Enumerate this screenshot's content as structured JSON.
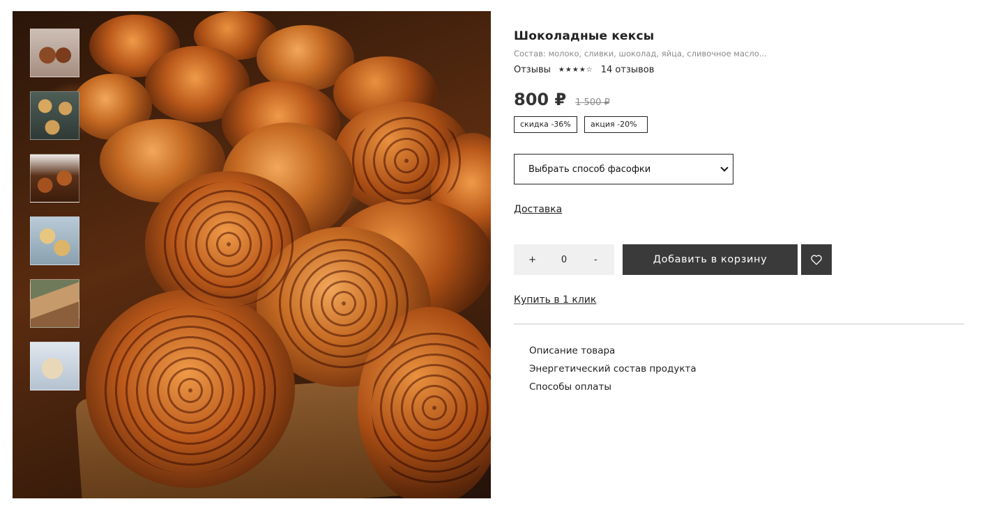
{
  "gallery": {
    "main_image": "cinnamon-rolls-photo",
    "thumbnails": [
      {
        "icon": "chocolate-cupcakes-thumbnail"
      },
      {
        "icon": "cookies-thumbnail"
      },
      {
        "icon": "cinnamon-buns-thumbnail"
      },
      {
        "icon": "blueberry-muffins-thumbnail"
      },
      {
        "icon": "pie-slices-thumbnail"
      },
      {
        "icon": "blueberry-pastry-thumbnail"
      }
    ]
  },
  "product": {
    "title": "Шоколадные кексы",
    "composition": "Состав: молоко, сливки, шоколад, яйца, сливочное масло...",
    "reviews_label": "Отзывы",
    "rating": 4,
    "rating_max": 5,
    "stars_text": "★★★★☆",
    "reviews_count": "14 отзывов",
    "price": "800 ₽",
    "old_price": "1 500 ₽",
    "badges": [
      "скидка -36%",
      "акция -20%"
    ],
    "packaging_select": "Выбрать способ фасофки",
    "delivery_link": "Доставка",
    "quantity": {
      "plus": "+",
      "value": "0",
      "minus": "-"
    },
    "add_to_cart": "Добавить в корзину",
    "buy_one_click": "Купить в 1 клик",
    "tabs": [
      "Описание товара",
      "Энергетический состав продукта",
      "Способы оплаты"
    ]
  },
  "colors": {
    "button_bg": "#3a3a3a",
    "text": "#222222",
    "muted": "#8a8a8a",
    "divider": "#c8c8c8",
    "qty_bg": "#f0f0f0"
  }
}
